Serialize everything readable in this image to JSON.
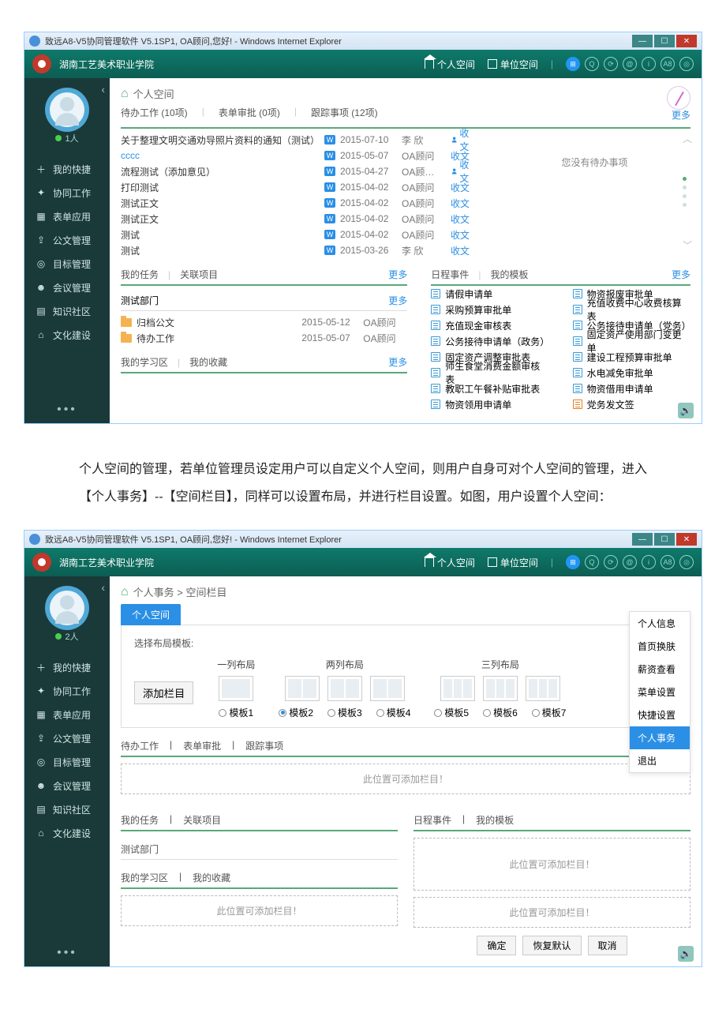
{
  "window_title": "致远A8-V5协同管理软件 V5.1SP1, OA顾问,您好! - Windows Internet Explorer",
  "org_name": "湖南工艺美术职业学院",
  "header": {
    "personal_space": "个人空间",
    "unit_space": "单位空间",
    "icons": [
      "⊞",
      "Q",
      "⟳",
      "@",
      "i",
      "A8",
      "◎"
    ]
  },
  "sidebar": {
    "user_count_1": "1人",
    "user_count_2": "2人",
    "items": [
      {
        "icon": "＋",
        "label": "我的快捷"
      },
      {
        "icon": "✦",
        "label": "协同工作"
      },
      {
        "icon": "▦",
        "label": "表单应用"
      },
      {
        "icon": "⇪",
        "label": "公文管理"
      },
      {
        "icon": "◎",
        "label": "目标管理"
      },
      {
        "icon": "☻",
        "label": "会议管理"
      },
      {
        "icon": "▤",
        "label": "知识社区"
      },
      {
        "icon": "⌂",
        "label": "文化建设"
      }
    ]
  },
  "screen1": {
    "breadcrumb": "个人空间",
    "tabs": {
      "a": "待办工作 (10项)",
      "b": "表单审批 (0项)",
      "c": "跟踪事项 (12项)"
    },
    "more": "更多",
    "tasks": [
      {
        "title": "关于整理文明交通劝导照片资料的通知（测试）",
        "badge": "W",
        "date": "2015-07-10",
        "user": "李 欣",
        "flag": "收文",
        "flagIcon": true
      },
      {
        "title": "cccc",
        "link": true,
        "badge": "W",
        "date": "2015-05-07",
        "user": "OA顾问",
        "flag": "收文"
      },
      {
        "title": "流程测试（添加意见）",
        "badge": "W",
        "date": "2015-04-27",
        "user": "OA顾…",
        "flag": "收文",
        "flagIcon": true
      },
      {
        "title": "打印测试",
        "badge": "W",
        "date": "2015-04-02",
        "user": "OA顾问",
        "flag": "收文"
      },
      {
        "title": "测试正文",
        "badge": "W",
        "date": "2015-04-02",
        "user": "OA顾问",
        "flag": "收文"
      },
      {
        "title": "测试正文",
        "badge": "W",
        "date": "2015-04-02",
        "user": "OA顾问",
        "flag": "收文"
      },
      {
        "title": "测试",
        "badge": "W",
        "date": "2015-04-02",
        "user": "OA顾问",
        "flag": "收文"
      },
      {
        "title": "测试",
        "badge": "W",
        "date": "2015-03-26",
        "user": "李 欣",
        "flag": "收文"
      }
    ],
    "pending_text": "您没有待办事项",
    "mytasks_tabs": {
      "a": "我的任务",
      "b": "关联项目"
    },
    "dept": "测试部门",
    "folders": [
      {
        "title": "归档公文",
        "date": "2015-05-12",
        "user": "OA顾问"
      },
      {
        "title": "待办工作",
        "date": "2015-05-07",
        "user": "OA顾问"
      }
    ],
    "mystudy_tabs": {
      "a": "我的学习区",
      "b": "我的收藏"
    },
    "sched_tabs": {
      "a": "日程事件",
      "b": "我的模板"
    },
    "templates_left": [
      "请假申请单",
      "采购预算审批单",
      "充值现金审核表",
      "公务接待申请单（政务）",
      "固定资产调整审批表",
      "师生食堂消费金额审核表",
      "教职工午餐补贴审批表",
      "物资领用申请单"
    ],
    "templates_right": [
      "物资报废审批单",
      "充值收费中心收费核算表",
      "公务接待申请单（党务）",
      "固定资产使用部门变更单",
      "建设工程预算审批单",
      "水电减免审批单",
      "物资借用申请单",
      "党务发文签"
    ]
  },
  "doc_text": "个人空间的管理，若单位管理员设定用户可以自定义个人空间，则用户自身可对个人空间的管理，进入【个人事务】--【空间栏目】，同样可以设置布局，并进行栏目设置。如图，用户设置个人空间：",
  "screen2": {
    "breadcrumb": "个人事务 > 空间栏目",
    "tab_chip": "个人空间",
    "layout_label": "选择布局模板:",
    "groups": {
      "g1": "一列布局",
      "g2": "两列布局",
      "g3": "三列布局"
    },
    "radios": [
      "模板1",
      "模板2",
      "模板3",
      "模板4",
      "模板5",
      "模板6",
      "模板7"
    ],
    "add_section": "添加栏目",
    "sect1": {
      "a": "待办工作",
      "b": "表单审批",
      "c": "跟踪事项"
    },
    "drop_text": "此位置可添加栏目！",
    "sect2": {
      "a": "我的任务",
      "b": "关联项目"
    },
    "sect3": {
      "a": "日程事件",
      "b": "我的模板"
    },
    "dept": "测试部门",
    "sect4": {
      "a": "我的学习区",
      "b": "我的收藏"
    },
    "buttons": {
      "ok": "确定",
      "reset": "恢复默认",
      "cancel": "取消"
    },
    "menu": [
      "个人信息",
      "首页换肤",
      "薪资查看",
      "菜单设置",
      "快捷设置",
      "个人事务",
      "退出"
    ],
    "menu_active": 5
  }
}
